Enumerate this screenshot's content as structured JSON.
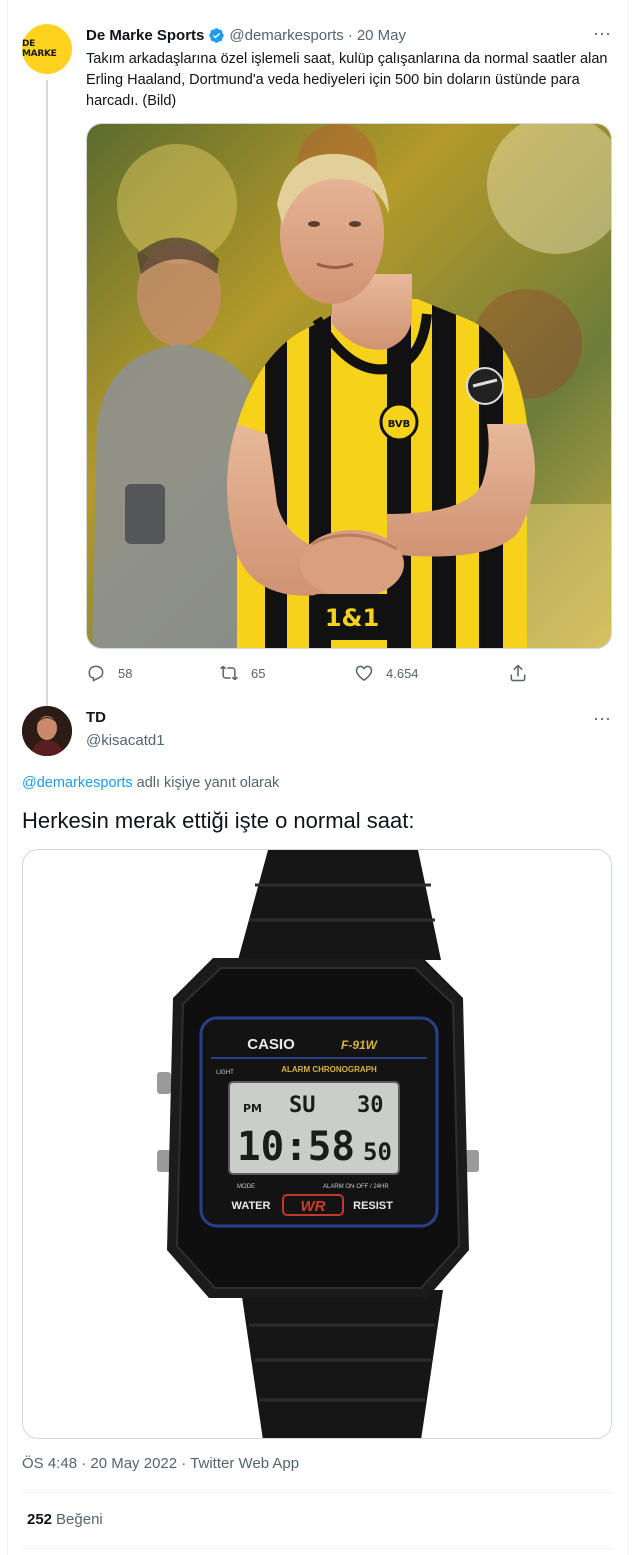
{
  "tweet1": {
    "avatar_text": "DE MARKE",
    "name": "De Marke Sports",
    "handle": "@demarkesports",
    "separator": "·",
    "date": "20 May",
    "text": "Takım arkadaşlarına özel işlemeli saat, kulüp çalışanlarına da normal saatler alan Erling Haaland, Dortmund'a veda hediyeleri için 500 bin doların üstünde para harcadı. (Bild)",
    "jersey_sponsor": "1&1",
    "badge_text": "BVB",
    "stats": {
      "replies": "58",
      "retweets": "65",
      "likes": "4.654"
    },
    "icons": [
      "verified-icon",
      "more-icon",
      "reply-icon",
      "retweet-icon",
      "like-icon",
      "share-icon"
    ]
  },
  "tweet2": {
    "name": "TD",
    "handle": "@kisacatd1",
    "replying_mention": "@demarkesports",
    "replying_suffix": " adlı kişiye yanıt olarak",
    "text": "Herkesin merak ettiği işte o normal saat:",
    "watch": {
      "brand": "CASIO",
      "model": "F-91W",
      "light_label": "LIGHT",
      "subtitle": "ALARM CHRONOGRAPH",
      "pm": "PM",
      "day": "SU",
      "date": "30",
      "time": "10:58",
      "seconds": "50",
      "mode_label": "MODE",
      "alarm_label": "ALARM  ON·OFF / 24HR",
      "water": "WATER",
      "wr": "WR",
      "resist": "RESIST"
    },
    "meta": "ÖS 4:48 · 20 May 2022 · Twitter Web App",
    "likes_count": "252",
    "likes_label": "Beğeni"
  },
  "colors": {
    "text": "#0f1419",
    "secondary": "#536471",
    "link": "#1d9bf0",
    "border": "#cfd9de",
    "bvb_yellow": "#f6d31a"
  }
}
